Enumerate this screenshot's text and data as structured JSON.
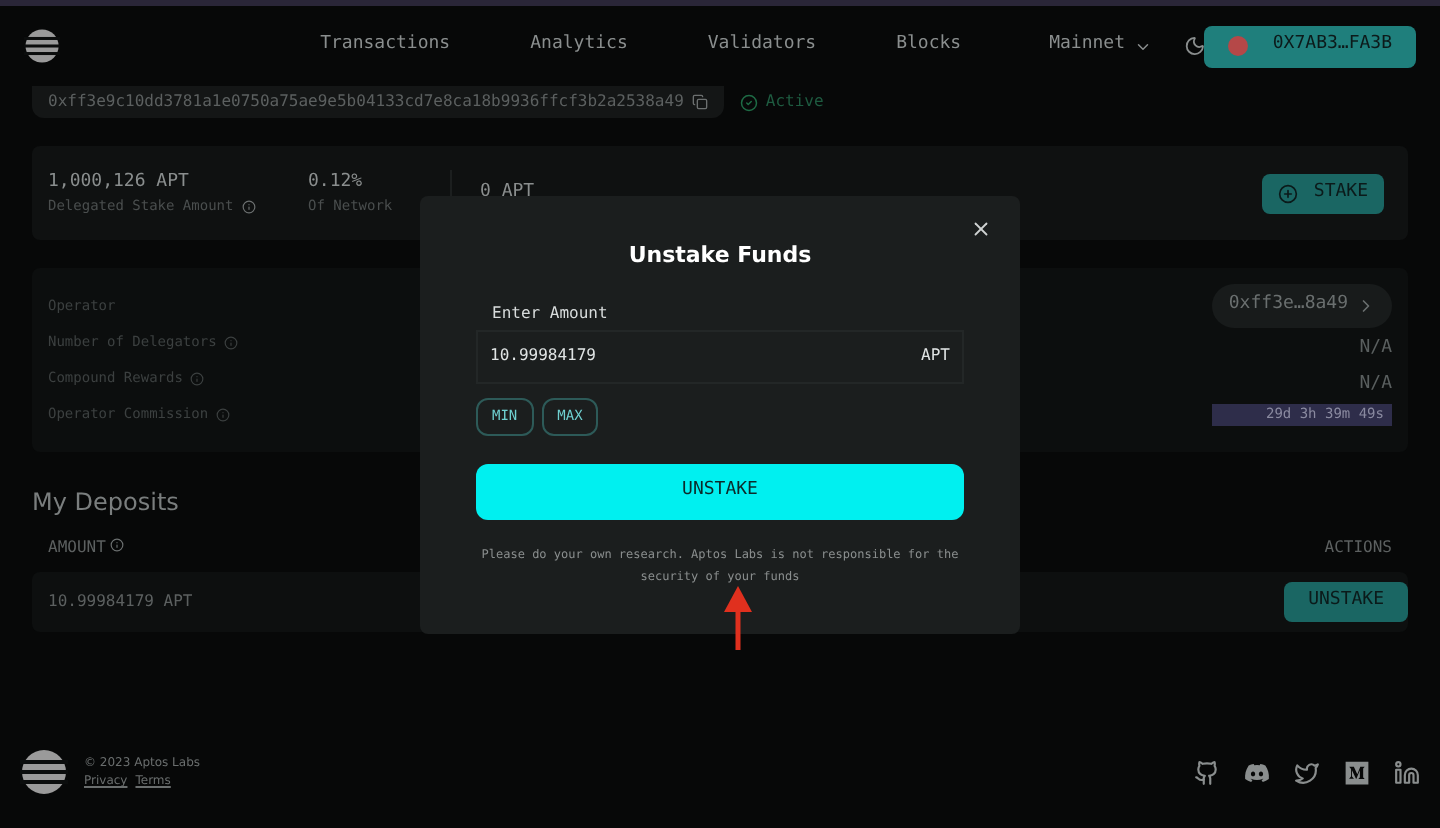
{
  "nav": {
    "links": [
      "Transactions",
      "Analytics",
      "Validators",
      "Blocks"
    ],
    "network": "Mainnet",
    "wallet": "0X7AB3…FA3B"
  },
  "validator": {
    "address": "0xff3e9c10dd3781a1e0750a75ae9e5b04133cd7e8ca18b9936ffcf3b2a2538a49",
    "status": "Active"
  },
  "stats": [
    {
      "value": "1,000,126 APT",
      "label": "Delegated Stake Amount"
    },
    {
      "value": "0.12%",
      "label": "Of Network"
    },
    {
      "value": "0 APT"
    }
  ],
  "stake_button": "STAKE",
  "details": [
    {
      "label": "Operator",
      "kind": "address",
      "value": "0xff3e…8a49"
    },
    {
      "label": "Number of Delegators",
      "kind": "text",
      "value": "N/A"
    },
    {
      "label": "Compound Rewards",
      "kind": "text",
      "value": "N/A"
    },
    {
      "label": "Operator Commission",
      "kind": "timer",
      "value": "29d 3h 39m 49s",
      "level": 1
    }
  ],
  "deposits": {
    "title": "My Deposits",
    "columns": [
      "AMOUNT",
      "ACTIONS"
    ],
    "rows": [
      {
        "amount": "10.99984179 APT",
        "action": "UNSTAKE"
      }
    ]
  },
  "modal": {
    "title": "Unstake Funds",
    "field_label": "Enter Amount",
    "value": "10.99984179",
    "unit": "APT",
    "quick": [
      "MIN",
      "MAX"
    ],
    "submit": "UNSTAKE",
    "note": "Please do your own research. Aptos Labs is not responsible for the security of your funds"
  },
  "footer": {
    "copyright": "© 2023 Aptos Labs",
    "links": [
      "Privacy",
      "Terms"
    ]
  }
}
